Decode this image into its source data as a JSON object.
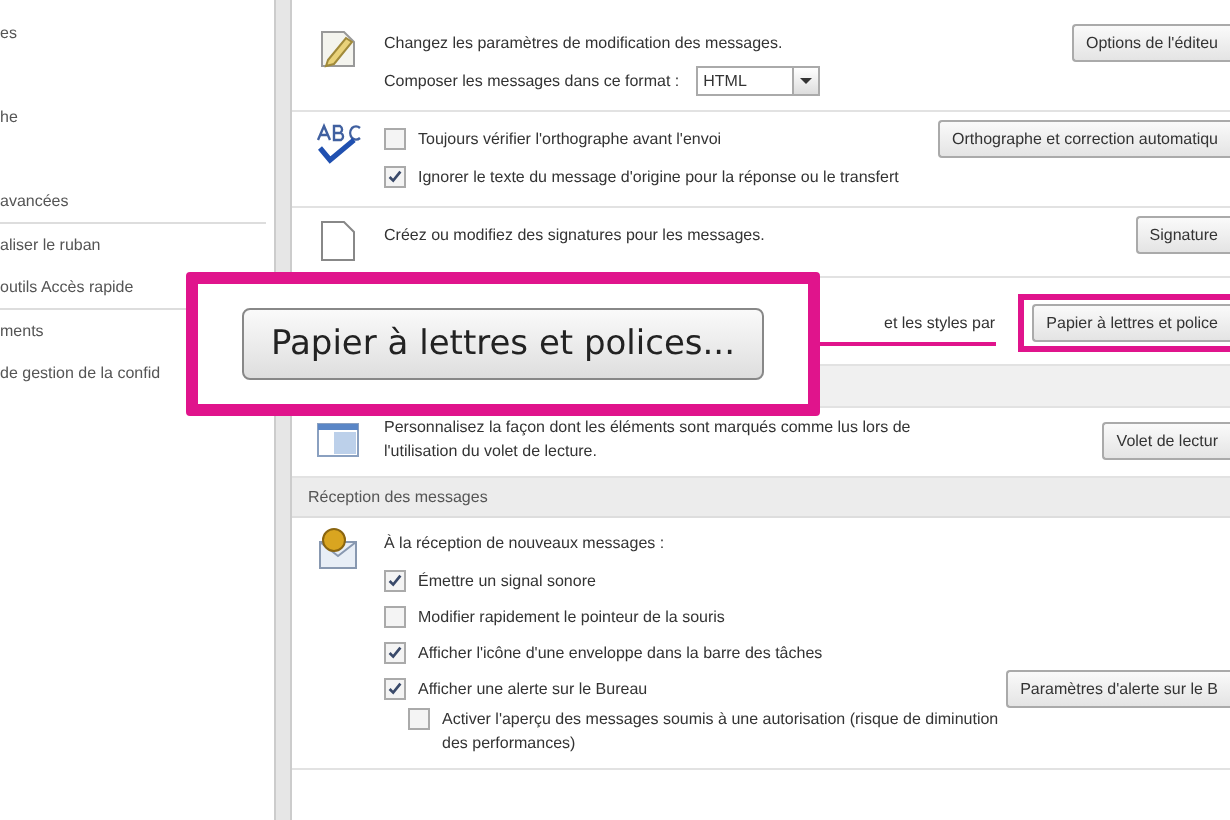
{
  "sidebar": {
    "items": [
      {
        "kind": "item",
        "label": "es"
      },
      {
        "kind": "item",
        "label": "he"
      },
      {
        "kind": "item",
        "label": "avancées"
      },
      {
        "kind": "divider"
      },
      {
        "kind": "item",
        "label": "aliser le ruban"
      },
      {
        "kind": "item",
        "label": "outils Accès rapide"
      },
      {
        "kind": "divider"
      },
      {
        "kind": "item",
        "label": "ments"
      },
      {
        "kind": "item",
        "label": "de gestion de la confid"
      }
    ]
  },
  "options": [
    {
      "kind": "row",
      "lines": [
        {
          "kind": "text",
          "text": "Changez les paramètres de modification des messages."
        },
        {
          "kind": "select",
          "label": "Composer les messages dans ce format :",
          "value": "HTML"
        }
      ],
      "button": "Options de l'éditeu"
    },
    {
      "kind": "row",
      "lines": [
        {
          "kind": "checkbox",
          "label": "Toujours vérifier l'orthographe avant l'envoi",
          "checked": false
        },
        {
          "kind": "checkbox",
          "label": "Ignorer le texte du message d'origine pour la réponse ou le transfert",
          "checked": true
        }
      ],
      "button": "Orthographe et correction automatiqu"
    },
    {
      "kind": "row",
      "lines": [
        {
          "kind": "text",
          "text": "Créez ou modifiez des signatures pour les messages."
        }
      ],
      "button": "Signature"
    },
    {
      "kind": "row",
      "lines": [
        {
          "kind": "text",
          "text": "et les styles par"
        }
      ],
      "button": "Papier à lettres et police",
      "highlighted": true
    },
    {
      "kind": "band"
    },
    {
      "kind": "row",
      "lines": [
        {
          "kind": "text",
          "text": "Personnalisez la façon dont les éléments sont marqués comme lus lors de l'utilisation du volet de lecture."
        }
      ],
      "button": "Volet de lectur"
    },
    {
      "kind": "header",
      "text": "Réception des messages"
    },
    {
      "kind": "row",
      "lines": [
        {
          "kind": "text",
          "text": "À la réception de nouveaux messages :"
        },
        {
          "kind": "checkbox",
          "label": "Émettre un signal sonore",
          "checked": true
        },
        {
          "kind": "checkbox",
          "label": "Modifier rapidement le pointeur de la souris",
          "checked": false
        },
        {
          "kind": "checkbox",
          "label": "Afficher l'icône d'une enveloppe dans la barre des tâches",
          "checked": true
        },
        {
          "kind": "checkbox",
          "label": "Afficher une alerte sur le Bureau",
          "checked": true,
          "button": "Paramètres d'alerte sur le B"
        },
        {
          "label": "Activer l'aperçu des messages soumis à une autorisation (risque de diminution des performances)",
          "checked": false,
          "kind": "sub_checkbox"
        }
      ]
    }
  ],
  "callout": {
    "button": "Papier à lettres et polices..."
  }
}
